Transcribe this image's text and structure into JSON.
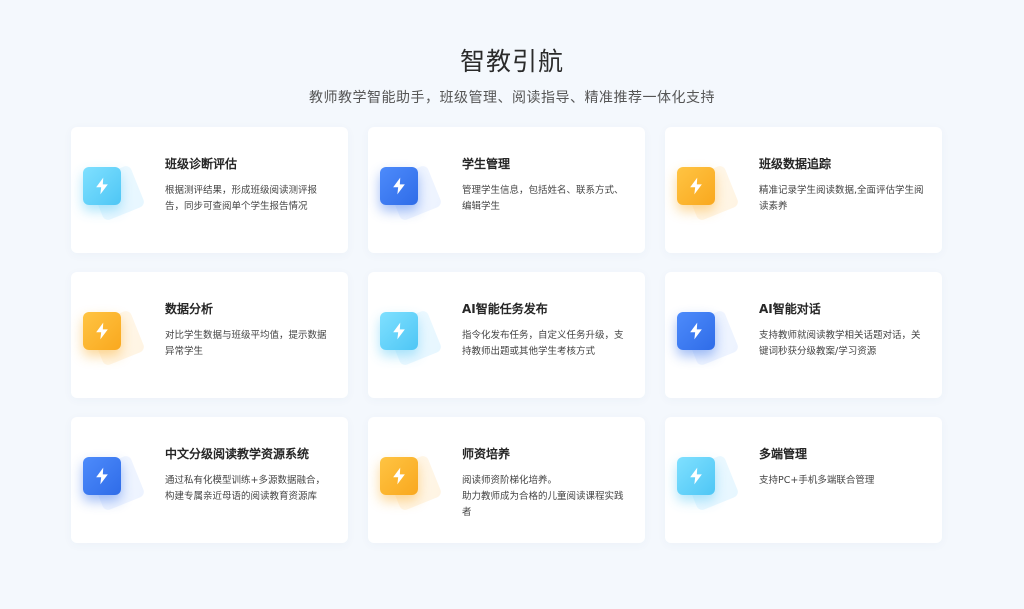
{
  "header": {
    "title": "智教引航",
    "subtitle": "教师教学智能助手，班级管理、阅读指导、精准推荐一体化支持"
  },
  "cards": [
    {
      "title": "班级诊断评估",
      "desc": "根据测评结果，形成班级阅读测评报告，同步可查阅单个学生报告情况",
      "color": "cyan",
      "icon": "lightning-icon"
    },
    {
      "title": "学生管理",
      "desc": "管理学生信息，包括姓名、联系方式、编辑学生",
      "color": "blue",
      "icon": "lightning-icon"
    },
    {
      "title": "班级数据追踪",
      "desc": "精准记录学生阅读数据,全面评估学生阅读素养",
      "color": "orange",
      "icon": "lightning-icon"
    },
    {
      "title": "数据分析",
      "desc": "对比学生数据与班级平均值，提示数据异常学生",
      "color": "orange",
      "icon": "lightning-icon"
    },
    {
      "title": "AI智能任务发布",
      "desc": "指令化发布任务，自定义任务升级，支持教师出题或其他学生考核方式",
      "color": "cyan",
      "icon": "lightning-icon"
    },
    {
      "title": "AI智能对话",
      "desc": "支持教师就阅读教学相关话题对话，关键词秒获分级教案/学习资源",
      "color": "blue",
      "icon": "lightning-icon"
    },
    {
      "title": "中文分级阅读教学资源系统",
      "desc": "通过私有化模型训练+多源数据融合，构建专属亲近母语的阅读教育资源库",
      "color": "blue",
      "icon": "lightning-icon"
    },
    {
      "title": "师资培养",
      "desc": "阅读师资阶梯化培养。\n助力教师成为合格的儿童阅读课程实践者",
      "color": "orange",
      "icon": "lightning-icon"
    },
    {
      "title": "多端管理",
      "desc": "支持PC+手机多端联合管理",
      "color": "cyan",
      "icon": "lightning-icon"
    }
  ]
}
